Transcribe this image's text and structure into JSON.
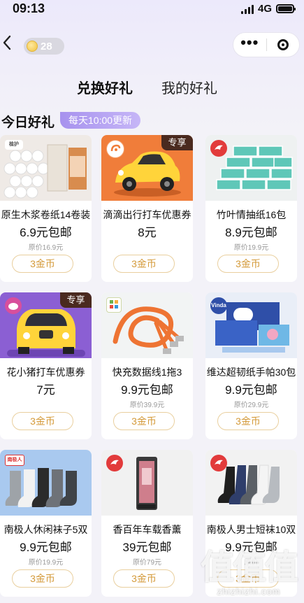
{
  "status_bar": {
    "time": "09:13",
    "network": "4G"
  },
  "header": {
    "coin_count": "28",
    "more_icon": "more-dots-icon",
    "target_icon": "target-icon"
  },
  "tabs": [
    {
      "label": "兑换好礼",
      "active": true
    },
    {
      "label": "我的好礼",
      "active": false
    }
  ],
  "section": {
    "title": "今日好礼",
    "badge": "每天10:00更新"
  },
  "products": [
    {
      "name": "原生木浆卷纸14卷装",
      "price": "6.9元包邮",
      "original": "原价16.9元",
      "cost": "3金币",
      "exclusive": ""
    },
    {
      "name": "滴滴出行打车优惠券",
      "price": "8元",
      "original": "",
      "cost": "3金币",
      "exclusive": "专享"
    },
    {
      "name": "竹叶情抽纸16包",
      "price": "8.9元包邮",
      "original": "原价19.9元",
      "cost": "3金币",
      "exclusive": ""
    },
    {
      "name": "花小猪打车优惠券",
      "price": "7元",
      "original": "",
      "cost": "3金币",
      "exclusive": "专享"
    },
    {
      "name": "快充数据线1拖3",
      "price": "9.9元包邮",
      "original": "原价39.9元",
      "cost": "3金币",
      "exclusive": ""
    },
    {
      "name": "维达超韧纸手帕30包",
      "price": "9.9元包邮",
      "original": "原价29.9元",
      "cost": "3金币",
      "exclusive": ""
    },
    {
      "name": "南极人休闲袜子5双",
      "price": "9.9元包邮",
      "original": "原价19.9元",
      "cost": "3金币",
      "exclusive": ""
    },
    {
      "name": "香百年车载香薰",
      "price": "39元包邮",
      "original": "原价79元",
      "cost": "3金币",
      "exclusive": ""
    },
    {
      "name": "南极人男士短袜10双",
      "price": "9.9元包邮",
      "original": "原价",
      "cost": "3金币",
      "exclusive": ""
    }
  ],
  "watermark": {
    "glyphs": "值值值",
    "url": "zhizhizhi.com"
  },
  "colors": {
    "accent_purple": "#a792ee",
    "coin_gold": "#d49a3a",
    "exclusive_tag": "#4a2a1f"
  }
}
